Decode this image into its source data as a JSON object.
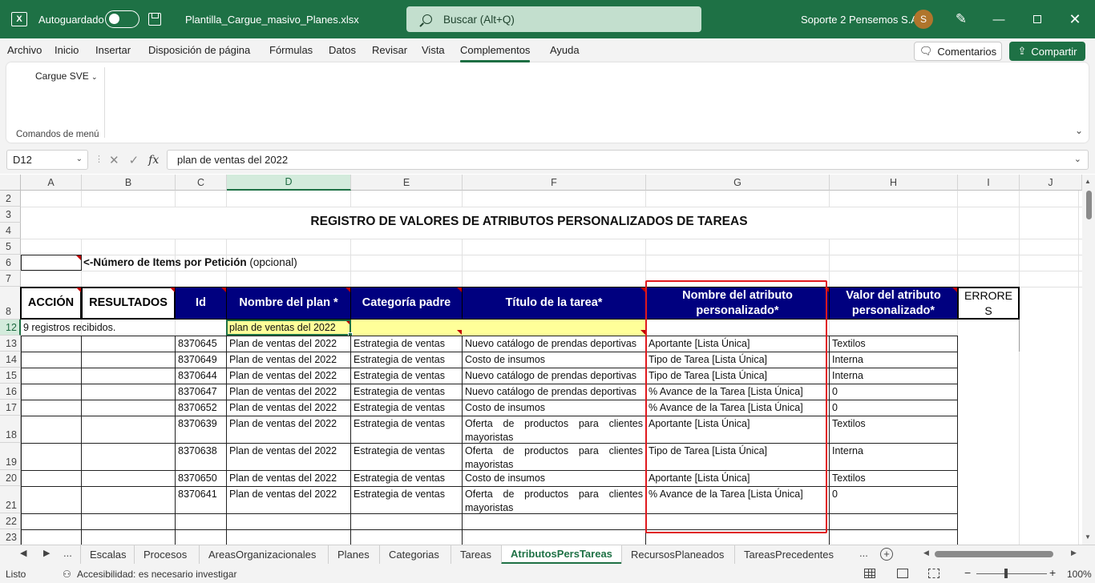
{
  "titlebar": {
    "app_icon": "excel-icon",
    "autosave_label": "Autoguardado",
    "filename": "Plantilla_Cargue_masivo_Planes.xlsx",
    "search_placeholder": "Buscar (Alt+Q)",
    "account": "Soporte 2 Pensemos S.A.",
    "avatar_initial": "S"
  },
  "menu": {
    "tabs": [
      "Archivo",
      "Inicio",
      "Insertar",
      "Disposición de página",
      "Fórmulas",
      "Datos",
      "Revisar",
      "Vista",
      "Complementos",
      "Ayuda"
    ],
    "active": "Complementos",
    "comments": "Comentarios",
    "share": "Compartir"
  },
  "ribbon": {
    "dropdown": "Cargue SVE",
    "group_label": "Comandos de menú"
  },
  "formula_bar": {
    "name_box": "D12",
    "fx": "fx",
    "formula": "plan de ventas del 2022"
  },
  "sheet": {
    "columns": [
      "A",
      "B",
      "C",
      "D",
      "E",
      "F",
      "G",
      "H",
      "I",
      "J"
    ],
    "selected_column": "D",
    "rows": [
      "2",
      "3",
      "4",
      "5",
      "6",
      "7",
      "8",
      "12",
      "13",
      "14",
      "15",
      "16",
      "17",
      "18",
      "19",
      "20",
      "21",
      "22",
      "23"
    ],
    "selected_row": "12",
    "title": "REGISTRO DE VALORES DE ATRIBUTOS PERSONALIZADOS  DE TAREAS",
    "items_label_bold": "<-Número de Items por Petición",
    "items_label_rest": " (opcional)",
    "headers": {
      "accion": "ACCIÓN",
      "resultados": "RESULTADOS",
      "id": "Id",
      "plan": "Nombre del plan *",
      "categoria": "Categoría padre",
      "titulo": "Título de la tarea*",
      "atributo": "Nombre del atributo personalizado*",
      "valor": "Valor del atributo personalizado*",
      "errores": "ERRORES"
    },
    "summary": "9 registros recibidos.",
    "selected_value": "plan de ventas del 2022",
    "data": [
      {
        "id": "8370645",
        "plan": "Plan de ventas del 2022",
        "cat": "Estrategia de ventas",
        "titulo": "Nuevo catálogo de prendas deportivas",
        "attr": "Aportante [Lista Única]",
        "valor": "Textilos"
      },
      {
        "id": "8370649",
        "plan": "Plan de ventas del 2022",
        "cat": "Estrategia de ventas",
        "titulo": "Costo de insumos",
        "attr": "Tipo de Tarea [Lista Única]",
        "valor": "Interna"
      },
      {
        "id": "8370644",
        "plan": "Plan de ventas del 2022",
        "cat": "Estrategia de ventas",
        "titulo": "Nuevo catálogo de prendas deportivas",
        "attr": "Tipo de Tarea [Lista Única]",
        "valor": "Interna"
      },
      {
        "id": "8370647",
        "plan": "Plan de ventas del 2022",
        "cat": "Estrategia de ventas",
        "titulo": "Nuevo catálogo de prendas deportivas",
        "attr": "% Avance de la Tarea [Lista Única]",
        "valor": "0"
      },
      {
        "id": "8370652",
        "plan": "Plan de ventas del 2022",
        "cat": "Estrategia de ventas",
        "titulo": "Costo de insumos",
        "attr": "% Avance de la Tarea [Lista Única]",
        "valor": "0"
      },
      {
        "id": "8370639",
        "plan": "Plan de ventas del 2022",
        "cat": "Estrategia de ventas",
        "titulo": "Oferta de productos para clientes mayoristas",
        "attr": "Aportante [Lista Única]",
        "valor": "Textilos"
      },
      {
        "id": "8370638",
        "plan": "Plan de ventas del 2022",
        "cat": "Estrategia de ventas",
        "titulo": "Oferta de productos para clientes mayoristas",
        "attr": "Tipo de Tarea [Lista Única]",
        "valor": "Interna"
      },
      {
        "id": "8370650",
        "plan": "Plan de ventas del 2022",
        "cat": "Estrategia de ventas",
        "titulo": "Costo de insumos",
        "attr": "Aportante [Lista Única]",
        "valor": "Textilos"
      },
      {
        "id": "8370641",
        "plan": "Plan de ventas del 2022",
        "cat": "Estrategia de ventas",
        "titulo": "Oferta de productos para clientes mayoristas",
        "attr": "% Avance de la Tarea [Lista Única]",
        "valor": "0"
      }
    ]
  },
  "sheet_tabs": {
    "ellipsis": "...",
    "tabs": [
      "Escalas",
      "Procesos",
      "AreasOrganizacionales",
      "Planes",
      "Categorias",
      "Tareas",
      "AtributosPersTareas",
      "RecursosPlaneados",
      "TareasPrecedentes"
    ],
    "active": "AtributosPersTareas"
  },
  "status": {
    "ready": "Listo",
    "accessibility": "Accesibilidad: es necesario investigar",
    "zoom": "100%"
  },
  "colors": {
    "excel_green": "#1e7145",
    "header_blue": "#00007f",
    "highlight_yellow": "#ffff99",
    "annotation_red": "#e0191e"
  }
}
